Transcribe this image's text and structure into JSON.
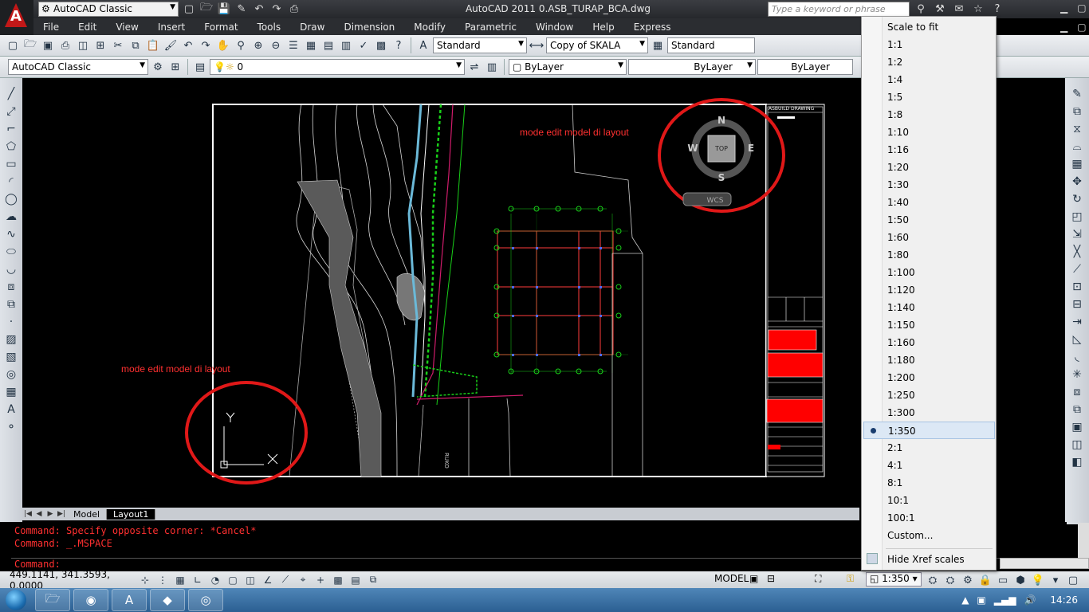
{
  "title_bar": {
    "app_logo": "A",
    "workspace": "AutoCAD Classic",
    "title": "AutoCAD 2011     0.ASB_TURAP_BCA.dwg",
    "search_placeholder": "Type a keyword or phrase"
  },
  "menu": [
    "File",
    "Edit",
    "View",
    "Insert",
    "Format",
    "Tools",
    "Draw",
    "Dimension",
    "Modify",
    "Parametric",
    "Window",
    "Help",
    "Express"
  ],
  "toolbar1": {
    "text_style": "Standard",
    "dim_style": "Copy of SKALA",
    "table_style": "Standard"
  },
  "toolbar2": {
    "workspace": "AutoCAD Classic",
    "layer": "0",
    "color": "ByLayer",
    "linetype": "ByLayer",
    "lineweight": "ByLayer"
  },
  "drawing": {
    "annotation_top": "mode edit model di layout",
    "annotation_left": "mode edit model di layout",
    "viewcube": {
      "n": "N",
      "s": "S",
      "e": "E",
      "w": "W",
      "face": "TOP",
      "wcs": "WCS"
    },
    "title_block_header": "ASBUILD DRAWING",
    "road_label": "RUKO",
    "ucs": {
      "x": "X",
      "y": "Y"
    },
    "colors": {
      "annotation": "#ff3030",
      "circle": "#e01818",
      "green": "#19d019",
      "magenta": "#d01c6b"
    }
  },
  "tabs": [
    "Model",
    "Layout1"
  ],
  "active_tab": "Layout1",
  "command_lines": [
    "Command: Specify opposite corner: *Cancel*",
    "Command: _.MSPACE",
    "Command:"
  ],
  "status": {
    "coords": "449.1141, 341.3593, 0.0000",
    "model_label": "MODEL",
    "scale": "1:350"
  },
  "scale_menu": {
    "items": [
      "Scale to fit",
      "1:1",
      "1:2",
      "1:4",
      "1:5",
      "1:8",
      "1:10",
      "1:16",
      "1:20",
      "1:30",
      "1:40",
      "1:50",
      "1:60",
      "1:80",
      "1:100",
      "1:120",
      "1:140",
      "1:150",
      "1:160",
      "1:180",
      "1:200",
      "1:250",
      "1:300",
      "1:350",
      "2:1",
      "4:1",
      "8:1",
      "10:1",
      "100:1",
      "Custom..."
    ],
    "selected": "1:350",
    "footer": "Hide Xref scales"
  },
  "taskbar": {
    "clock": "14:26"
  }
}
